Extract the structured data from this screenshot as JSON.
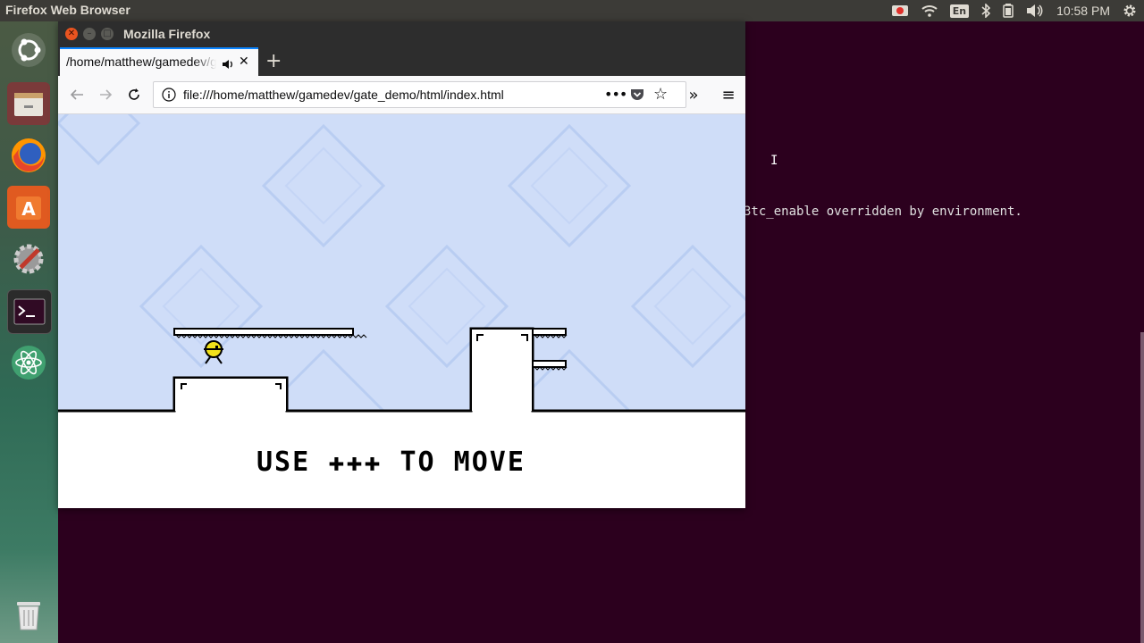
{
  "top_panel": {
    "app_title": "Firefox Web Browser",
    "language": "En",
    "clock": "10:58 PM",
    "indicators": [
      "record-icon",
      "wifi-icon",
      "bluetooth-icon",
      "battery-icon",
      "volume-icon",
      "gear-icon"
    ]
  },
  "launcher": {
    "items": [
      "ubuntu-dash",
      "files",
      "firefox",
      "software-center",
      "system-settings",
      "terminal",
      "atom",
      "trash"
    ]
  },
  "terminal": {
    "output_line": "3tc_enable overridden by environment."
  },
  "browser": {
    "window_title": "Mozilla Firefox",
    "tab_title": "/home/matthew/gamedev/gate_demo/html/index.html",
    "url": "file:///home/matthew/gamedev/gate_demo/html/index.html"
  },
  "game": {
    "message_prefix": "USE",
    "message_suffix": "TO MOVE",
    "arrow_glyphs": [
      "✚",
      "✚",
      "✚"
    ]
  },
  "colors": {
    "desktop_bg": "#2c001e",
    "panel_bg": "#3c3b37",
    "sky": "#cfddf8",
    "tab_accent": "#0a84ff"
  }
}
